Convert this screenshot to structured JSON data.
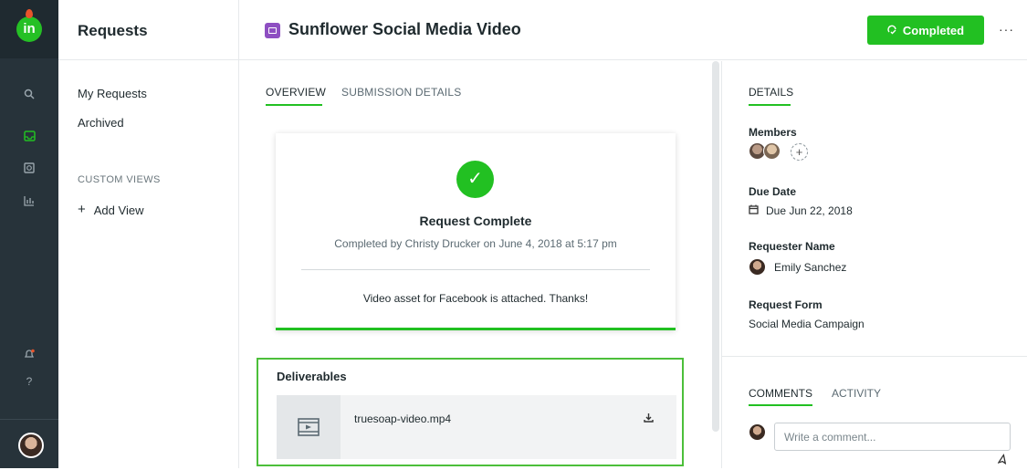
{
  "rail": {
    "logo_text": "in",
    "icons": [
      "search-icon",
      "inbox-icon",
      "search-doc-icon",
      "chart-icon",
      "bell-icon",
      "help-icon"
    ],
    "help_glyph": "?"
  },
  "subnav": {
    "title": "Requests",
    "items": [
      {
        "label": "My Requests"
      },
      {
        "label": "Archived"
      }
    ],
    "section_label": "CUSTOM VIEWS",
    "add_view_label": "Add View",
    "add_glyph": "+"
  },
  "header": {
    "title": "Sunflower Social Media Video",
    "status_label": "Completed",
    "more_label": "···"
  },
  "main": {
    "tabs": [
      {
        "label": "OVERVIEW",
        "active": true
      },
      {
        "label": "SUBMISSION DETAILS",
        "active": false
      }
    ],
    "card": {
      "title": "Request Complete",
      "subtitle": "Completed by Christy Drucker on June 4, 2018 at 5:17 pm",
      "message": "Video asset for Facebook is attached. Thanks!"
    },
    "deliverables": {
      "title": "Deliverables",
      "file_name": "truesoap-video.mp4"
    }
  },
  "details": {
    "tab_label": "DETAILS",
    "members_label": "Members",
    "due_date_label": "Due Date",
    "due_date_value": "Due Jun 22, 2018",
    "requester_label": "Requester Name",
    "requester_value": "Emily Sanchez",
    "form_label": "Request Form",
    "form_value": "Social Media Campaign"
  },
  "comments": {
    "tabs": [
      {
        "label": "COMMENTS",
        "active": true
      },
      {
        "label": "ACTIVITY",
        "active": false
      }
    ],
    "placeholder": "Write a comment..."
  },
  "colors": {
    "accent": "#22c022",
    "rail": "#27333a",
    "request_icon": "#8e4fc2"
  }
}
